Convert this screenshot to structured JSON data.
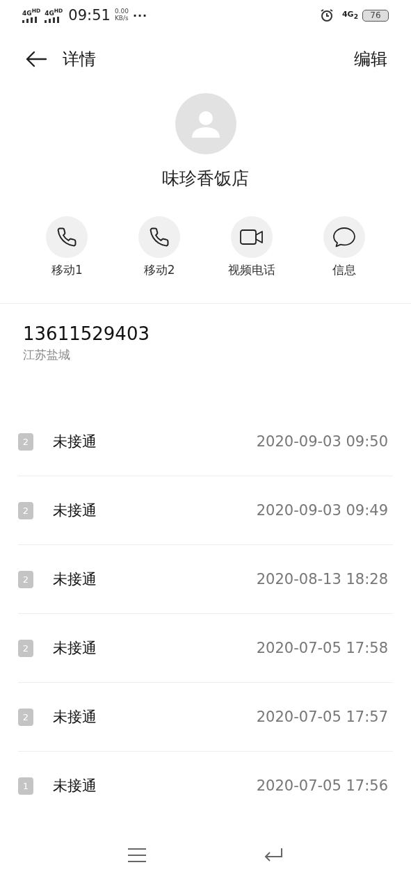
{
  "status_bar": {
    "network_1": "4G",
    "network_1_sup": "HD",
    "network_2": "4G",
    "network_2_sup": "HD",
    "time": "09:51",
    "speed": "0.00",
    "speed_unit": "KB/s",
    "more": "···",
    "network_3": "4G",
    "network_3_sub": "2",
    "battery": "76"
  },
  "header": {
    "title": "详情",
    "action": "编辑"
  },
  "contact": {
    "name": "味珍香饭店"
  },
  "actions": [
    {
      "kind": "phone",
      "label": "移动1"
    },
    {
      "kind": "phone",
      "label": "移动2"
    },
    {
      "kind": "video",
      "label": "视频电话"
    },
    {
      "kind": "message",
      "label": "信息"
    }
  ],
  "number": {
    "value": "13611529403",
    "location": "江苏盐城"
  },
  "calls": [
    {
      "sim": "2",
      "status": "未接通",
      "time": "2020-09-03 09:50"
    },
    {
      "sim": "2",
      "status": "未接通",
      "time": "2020-09-03 09:49"
    },
    {
      "sim": "2",
      "status": "未接通",
      "time": "2020-08-13 18:28"
    },
    {
      "sim": "2",
      "status": "未接通",
      "time": "2020-07-05 17:58"
    },
    {
      "sim": "2",
      "status": "未接通",
      "time": "2020-07-05 17:57"
    },
    {
      "sim": "1",
      "status": "未接通",
      "time": "2020-07-05 17:56"
    }
  ]
}
